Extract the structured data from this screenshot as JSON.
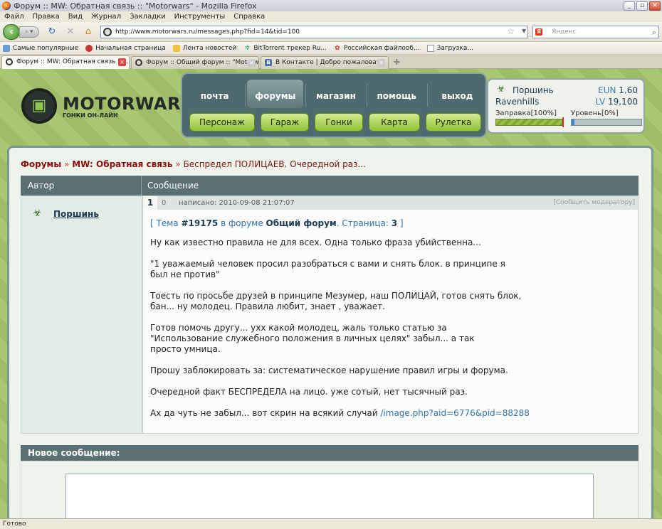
{
  "window": {
    "title": "Форум :: MW: Обратная связь :: \"Motorwars\" - Mozilla Firefox"
  },
  "menu": [
    "Файл",
    "Правка",
    "Вид",
    "Журнал",
    "Закладки",
    "Инструменты",
    "Справка"
  ],
  "toolbar": {
    "url": "http://www.motorwars.ru/messages.php?fid=14&tid=100",
    "search_placeholder": "Яндекс",
    "yandex_letter": "Я"
  },
  "bookmarks": [
    {
      "label": "Самые популярные"
    },
    {
      "label": "Начальная страница"
    },
    {
      "label": "Лента новостей"
    },
    {
      "label": "BitTorrent трекер Ru..."
    },
    {
      "label": "Российская файлооб..."
    },
    {
      "label": "Загрузка..."
    }
  ],
  "tabs": [
    {
      "label": "Форум :: MW: Обратная связь :: ..."
    },
    {
      "label": "Форум :: Общий форум :: \"Motorwars\""
    },
    {
      "label": "В Контакте | Добро пожаловать"
    }
  ],
  "site": {
    "logo_text": "MOTORWARS.RU",
    "logo_sub": "ГОНКИ ОН-ЛАЙН",
    "top_nav": [
      "почта",
      "форумы",
      "магазин",
      "помощь",
      "выход"
    ],
    "bottom_nav": [
      "Персонаж",
      "Гараж",
      "Гонки",
      "Карта",
      "Рулетка"
    ]
  },
  "user": {
    "name": "Поршинь",
    "city": "Ravenhills",
    "eun_label": "EUN",
    "eun_value": "1.60",
    "lv_label": "LV",
    "lv_value": "19,100",
    "fuel_label": "Заправка[100%]",
    "fuel_percent": 100,
    "level_label": "Уровень[0%]",
    "level_percent": 0
  },
  "breadcrumb": {
    "root": "Форумы",
    "sep1": "»",
    "forum": "MW: Обратная связь",
    "sep2": "»",
    "topic": "Беспредел ПОЛИЦАЕВ. Очередной раз..."
  },
  "table": {
    "col_author": "Автор",
    "col_message": "Сообщение"
  },
  "post": {
    "author": "Поршинь",
    "number": "1",
    "rating": "0",
    "date": "написано: 2010-09-08 21:07:07",
    "report": "[Сообщить модератору]",
    "title_open": "[ Тема ",
    "topic_id": "#19175",
    "title_mid": " в форуме ",
    "forum_name": "Общий форум",
    "title_page": ". Страница: ",
    "page": "3",
    "title_close": " ]",
    "paragraphs": [
      "Ну как известно правила не для всех. Одна только фраза убийственна...",
      "\"1 уважаемый человек просил разобраться с вами и снять блок. в принципе я\nбыл не против\"",
      "Тоесть по просьбе друзей в принципе Мезумер, наш ПОЛИЦАЙ, готов снять блок,\nбан... ну молодец. Правила любит, знает , уважает.",
      "Готов помочь другу... ухх какой молодец, жаль только статью за\n\"Использование служебного положения в личных целях\" забыл... а так\nпросто умница.",
      "Прошу заблокировать за: систематическое нарушение правил игры и форума.",
      "Очередной факт БЕСПРЕДЕЛА на лицо. уже сотый, нет тысячный раз."
    ],
    "last_line": "Ах да чуть не забыл... вот скрин на всякий случай ",
    "link": "/image.php?aid=6776&pid=88288"
  },
  "new_message": {
    "title": "Новое сообщение:"
  },
  "status": "Готово"
}
